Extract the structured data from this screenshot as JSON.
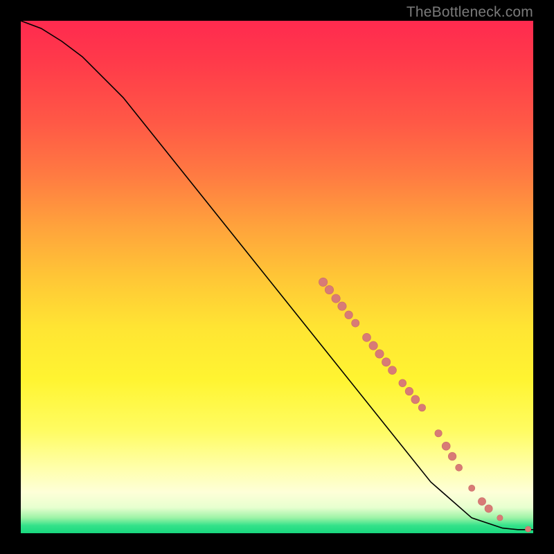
{
  "watermark": "TheBottleneck.com",
  "colors": {
    "curve": "#000000",
    "marker_fill": "#d87b76",
    "marker_stroke": "#c96b66"
  },
  "chart_data": {
    "type": "line",
    "title": "",
    "xlabel": "",
    "ylabel": "",
    "xlim": [
      0,
      100
    ],
    "ylim": [
      0,
      100
    ],
    "grid": false,
    "legend": false,
    "series": [
      {
        "name": "curve",
        "x": [
          0,
          4,
          8,
          12,
          20,
          30,
          40,
          50,
          60,
          70,
          80,
          88,
          94,
          97,
          100
        ],
        "y": [
          100,
          98.5,
          96,
          93,
          85,
          72.5,
          60,
          47.5,
          35,
          22.5,
          10,
          3,
          1,
          0.7,
          0.7
        ]
      }
    ],
    "markers": [
      {
        "x": 59.0,
        "y": 49.0,
        "r": 6.2
      },
      {
        "x": 60.2,
        "y": 47.5,
        "r": 6.2
      },
      {
        "x": 61.5,
        "y": 45.8,
        "r": 6.2
      },
      {
        "x": 62.7,
        "y": 44.3,
        "r": 6.2
      },
      {
        "x": 64.0,
        "y": 42.6,
        "r": 5.8
      },
      {
        "x": 65.3,
        "y": 41.0,
        "r": 5.6
      },
      {
        "x": 67.5,
        "y": 38.2,
        "r": 6.0
      },
      {
        "x": 68.8,
        "y": 36.6,
        "r": 6.2
      },
      {
        "x": 70.0,
        "y": 35.0,
        "r": 6.2
      },
      {
        "x": 71.3,
        "y": 33.4,
        "r": 6.2
      },
      {
        "x": 72.5,
        "y": 31.8,
        "r": 6.0
      },
      {
        "x": 74.5,
        "y": 29.3,
        "r": 5.4
      },
      {
        "x": 75.8,
        "y": 27.7,
        "r": 5.8
      },
      {
        "x": 77.0,
        "y": 26.1,
        "r": 6.0
      },
      {
        "x": 78.3,
        "y": 24.5,
        "r": 5.2
      },
      {
        "x": 81.5,
        "y": 19.5,
        "r": 5.2
      },
      {
        "x": 83.0,
        "y": 17.0,
        "r": 6.0
      },
      {
        "x": 84.2,
        "y": 15.0,
        "r": 5.8
      },
      {
        "x": 85.5,
        "y": 12.8,
        "r": 5.0
      },
      {
        "x": 88.0,
        "y": 8.8,
        "r": 4.6
      },
      {
        "x": 90.0,
        "y": 6.2,
        "r": 5.6
      },
      {
        "x": 91.3,
        "y": 4.8,
        "r": 5.6
      },
      {
        "x": 93.5,
        "y": 3.0,
        "r": 4.2
      },
      {
        "x": 99.0,
        "y": 0.8,
        "r": 4.2
      }
    ]
  }
}
